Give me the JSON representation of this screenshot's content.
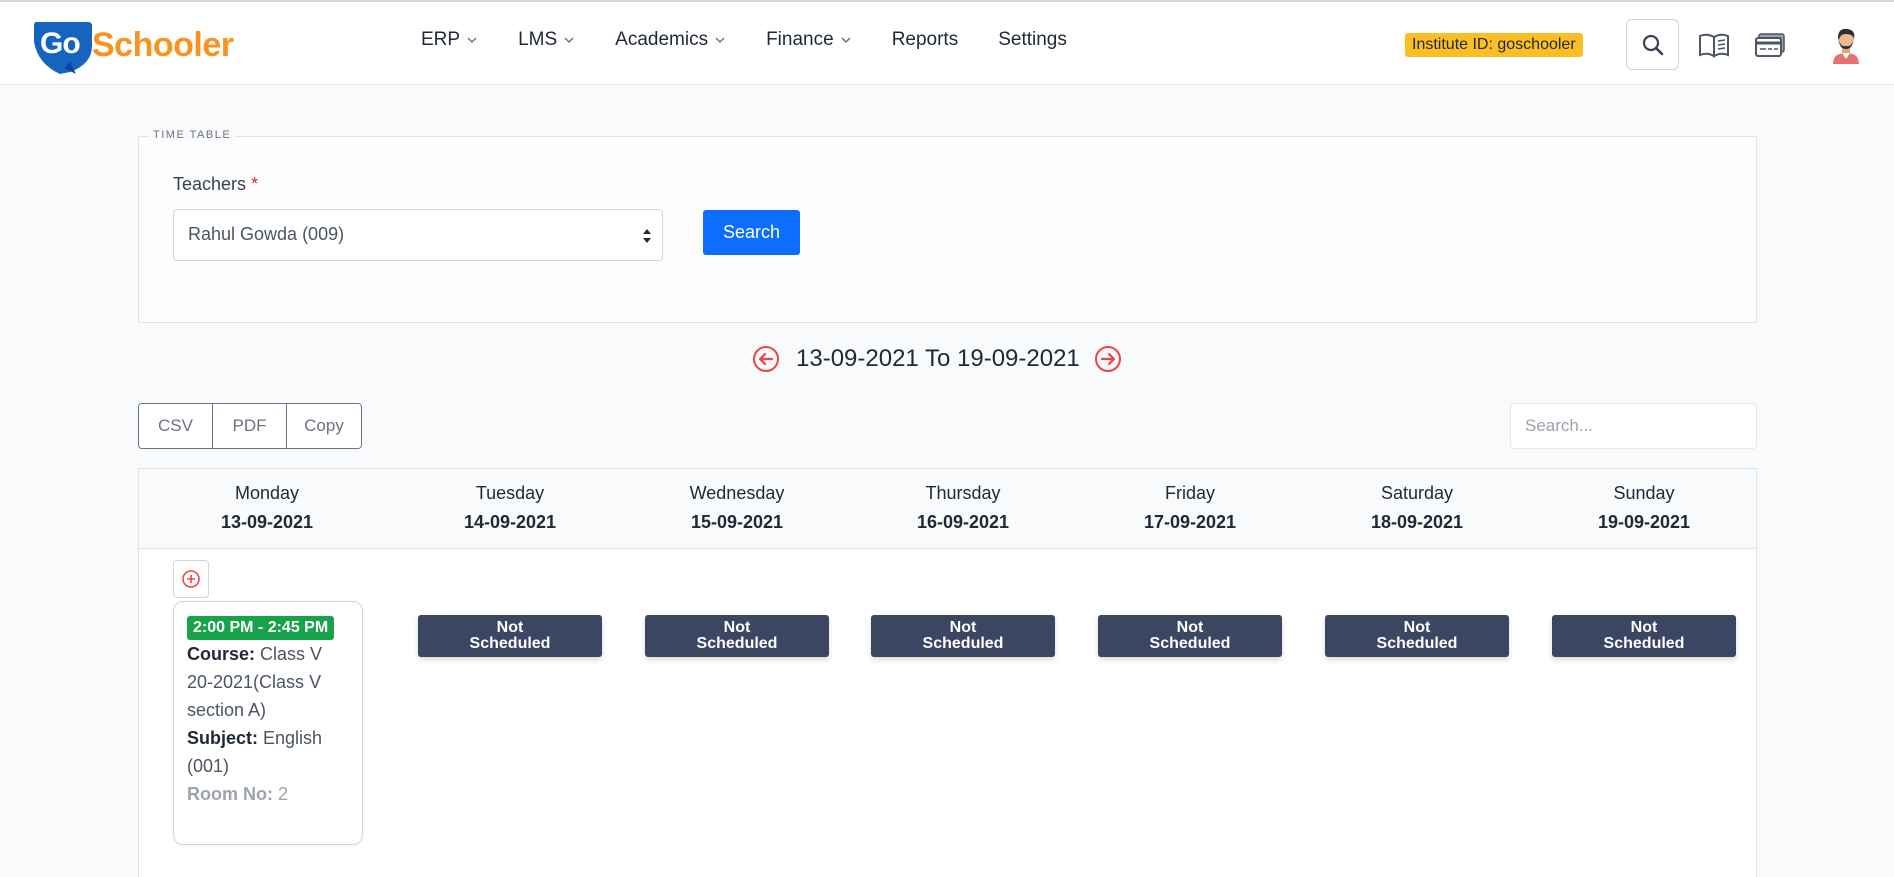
{
  "brand": {
    "go": "Go",
    "name": "Schooler"
  },
  "nav": {
    "items": [
      {
        "label": "ERP",
        "dropdown": true
      },
      {
        "label": "LMS",
        "dropdown": true
      },
      {
        "label": "Academics",
        "dropdown": true
      },
      {
        "label": "Finance",
        "dropdown": true
      },
      {
        "label": "Reports",
        "dropdown": false
      },
      {
        "label": "Settings",
        "dropdown": false
      }
    ]
  },
  "header": {
    "institute_badge": "Institute ID: goschooler",
    "icons": [
      "search-icon",
      "book-icon",
      "card-icon",
      "avatar"
    ]
  },
  "timetable": {
    "legend": "TIME TABLE",
    "teachers_label": "Teachers",
    "required_mark": "*",
    "selected_teacher": "Rahul Gowda (009)",
    "search_label": "Search"
  },
  "date_range": "13-09-2021 To 19-09-2021",
  "export": {
    "csv": "CSV",
    "pdf": "PDF",
    "copy": "Copy"
  },
  "table_search": {
    "placeholder": "Search..."
  },
  "days": [
    {
      "name": "Monday",
      "date": "13-09-2021"
    },
    {
      "name": "Tuesday",
      "date": "14-09-2021"
    },
    {
      "name": "Wednesday",
      "date": "15-09-2021"
    },
    {
      "name": "Thursday",
      "date": "16-09-2021"
    },
    {
      "name": "Friday",
      "date": "17-09-2021"
    },
    {
      "name": "Saturday",
      "date": "18-09-2021"
    },
    {
      "name": "Sunday",
      "date": "19-09-2021"
    }
  ],
  "slot": {
    "time": "2:00 PM - 2:45 PM",
    "course_label": "Course:",
    "course_value": "Class V 20-2021(Class V section A)",
    "subject_label": "Subject:",
    "subject_value": "English (001)",
    "room_label": "Room No:",
    "room_value": "2"
  },
  "not_scheduled": {
    "line1": "Not",
    "line2": "Scheduled"
  },
  "colors": {
    "primary": "#0d6efd",
    "brand_orange": "#f7931e",
    "brand_blue": "#1565c0",
    "badge_yellow": "#fbbf24",
    "time_green": "#16a34a",
    "not_scheduled_bg": "#3b4663",
    "arrow_red": "#ef4444"
  }
}
